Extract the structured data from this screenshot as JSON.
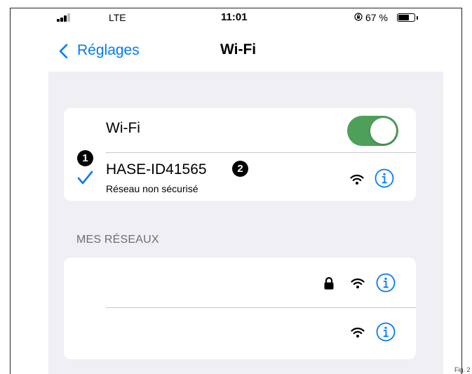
{
  "status_bar": {
    "carrier": "LTE",
    "time": "11:01",
    "battery_percent": "67 %",
    "battery_level": 0.67,
    "signal_bars_filled": 3,
    "signal_bars_total": 4
  },
  "nav": {
    "back_label": "Réglages",
    "title": "Wi-Fi",
    "accent_color": "#007aff"
  },
  "wifi_section": {
    "toggle_label": "Wi-Fi",
    "toggle_on": true,
    "toggle_color": "#4e9f5a"
  },
  "connected_network": {
    "name": "HASE-ID41565",
    "subtitle": "Réseau non sécurisé",
    "connected": true
  },
  "callouts": {
    "first": "1",
    "second": "2"
  },
  "my_networks": {
    "header": "MES RÉSEAUX",
    "items": [
      {
        "name": "",
        "locked": true
      },
      {
        "name": "",
        "locked": false
      }
    ]
  },
  "figure_label": "Fig. 2",
  "icons": {
    "signal": "cellular-signal-icon",
    "rotation_lock": "rotation-lock-icon",
    "battery": "battery-icon",
    "back": "chevron-left-icon",
    "check": "checkmark-icon",
    "wifi": "wifi-icon",
    "info": "info-icon",
    "lock": "lock-icon"
  }
}
